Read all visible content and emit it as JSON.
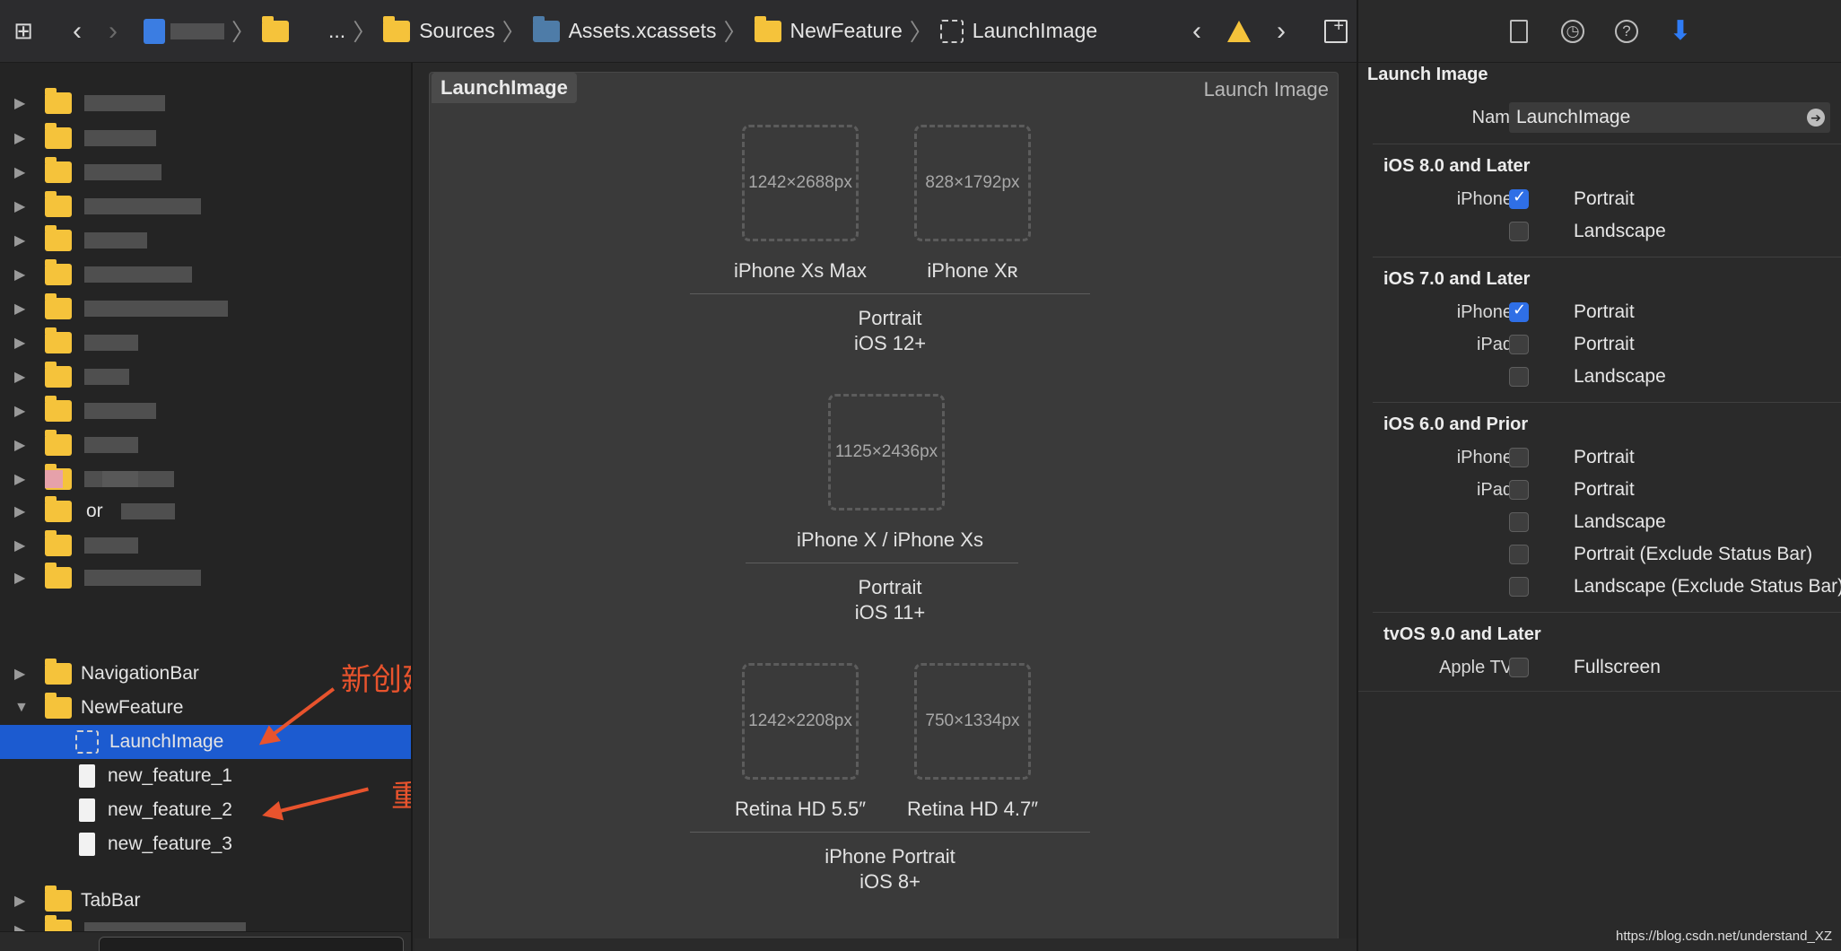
{
  "jumpbar": {
    "crumbs": [
      "...",
      "Sources",
      "Assets.xcassets",
      "NewFeature",
      "LaunchImage"
    ]
  },
  "navigator": {
    "rows": [
      {
        "label": "NavigationBar",
        "expanded": false
      },
      {
        "label": "NewFeature",
        "expanded": true
      },
      {
        "label": "LaunchImage",
        "selected": true
      },
      {
        "label": "new_feature_1"
      },
      {
        "label": "new_feature_2"
      },
      {
        "label": "new_feature_3"
      },
      {
        "label": "TabBar",
        "expanded": false
      }
    ],
    "partial_label": "or"
  },
  "annotations": {
    "create_note": "新创建一个LaunchImage",
    "rename_note": "重命名",
    "color": "#e8532d"
  },
  "editor": {
    "set_name": "LaunchImage",
    "set_type": "Launch Image",
    "slots": [
      {
        "size": "1242×2688px",
        "label": "iPhone Xs Max"
      },
      {
        "size": "828×1792px",
        "label": "iPhone Xʀ"
      },
      {
        "size": "1125×2436px",
        "label": "iPhone X / iPhone Xs"
      },
      {
        "size": "1242×2208px",
        "label": "Retina HD 5.5″"
      },
      {
        "size": "750×1334px",
        "label": "Retina HD 4.7″"
      }
    ],
    "groups": [
      {
        "line1": "Portrait",
        "line2": "iOS 12+"
      },
      {
        "line1": "Portrait",
        "line2": "iOS 11+"
      },
      {
        "line1": "iPhone Portrait",
        "line2": "iOS 8+"
      }
    ]
  },
  "inspector": {
    "title": "Launch Image",
    "name_label": "Name",
    "name_value": "LaunchImage",
    "sections": [
      {
        "title": "iOS 8.0 and Later",
        "options": [
          {
            "device": "iPhone",
            "label": "Portrait",
            "checked": true
          },
          {
            "device": "",
            "label": "Landscape",
            "checked": false
          }
        ]
      },
      {
        "title": "iOS 7.0 and Later",
        "options": [
          {
            "device": "iPhone",
            "label": "Portrait",
            "checked": true
          },
          {
            "device": "iPad",
            "label": "Portrait",
            "checked": false
          },
          {
            "device": "",
            "label": "Landscape",
            "checked": false
          }
        ]
      },
      {
        "title": "iOS 6.0 and Prior",
        "options": [
          {
            "device": "iPhone",
            "label": "Portrait",
            "checked": false
          },
          {
            "device": "iPad",
            "label": "Portrait",
            "checked": false
          },
          {
            "device": "",
            "label": "Landscape",
            "checked": false
          },
          {
            "device": "",
            "label": "Portrait (Exclude Status Bar)",
            "checked": false
          },
          {
            "device": "",
            "label": "Landscape (Exclude Status Bar)",
            "checked": false
          }
        ]
      },
      {
        "title": "tvOS 9.0 and Later",
        "options": [
          {
            "device": "Apple TV",
            "label": "Fullscreen",
            "checked": false
          }
        ]
      }
    ],
    "accent_color": "#2f6fe6"
  },
  "watermark": "https://blog.csdn.net/understand_XZ"
}
